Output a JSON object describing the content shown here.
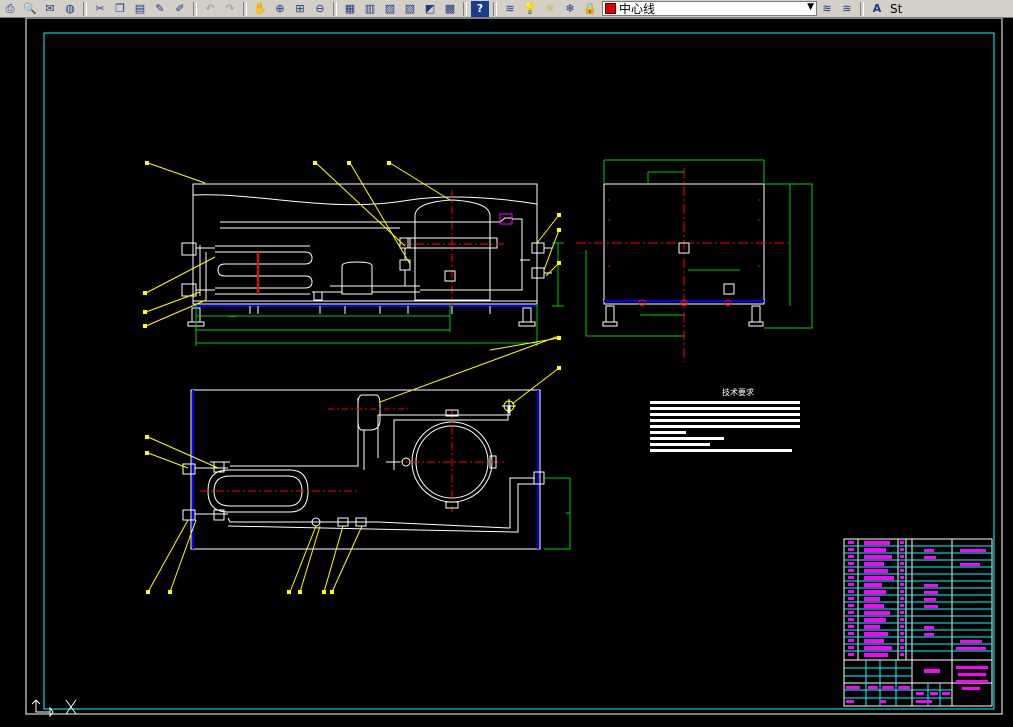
{
  "toolbar": {
    "icons": [
      "print-icon",
      "print-preview-icon",
      "publish-icon",
      "globe-icon",
      "cut-icon",
      "copy-icon",
      "paste-icon",
      "match-properties-icon",
      "brush-icon",
      "undo-icon",
      "redo-icon",
      "pan-icon",
      "zoom-realtime-icon",
      "zoom-window-icon",
      "zoom-previous-icon",
      "properties-icon",
      "design-center-icon",
      "tool-palettes-icon",
      "sheet-set-icon",
      "markup-icon",
      "calculator-icon",
      "help-icon",
      "layer-manager-icon",
      "bulb-icon",
      "sun-icon",
      "freeze-icon",
      "lock-icon"
    ],
    "layer_name": "中心线",
    "layer_color": "#e00000",
    "style_prefix": "St"
  },
  "drawing": {
    "background": "#000000",
    "tech_requirements_title": "技术要求",
    "colors": {
      "frame": "#ffffff",
      "border": "#00ffff",
      "leader": "#ffff00",
      "dimension": "#00cc00",
      "centerline": "#ff0000",
      "titleblock_fill": "#ff00ff"
    }
  }
}
